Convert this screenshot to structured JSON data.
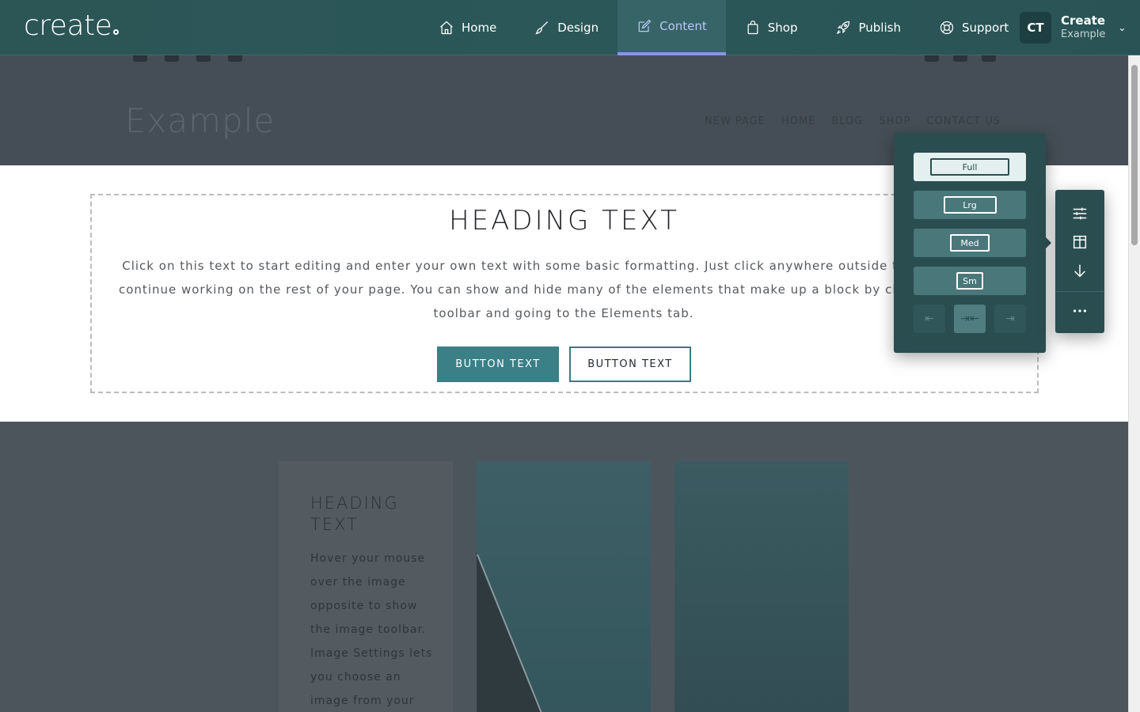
{
  "app": {
    "logo": "create",
    "nav": [
      {
        "label": "Home",
        "icon": "home-icon"
      },
      {
        "label": "Design",
        "icon": "brush-icon"
      },
      {
        "label": "Content",
        "icon": "edit-icon",
        "active": true
      },
      {
        "label": "Shop",
        "icon": "bag-icon"
      },
      {
        "label": "Publish",
        "icon": "rocket-icon"
      },
      {
        "label": "Support",
        "icon": "lifebuoy-icon"
      }
    ],
    "account": {
      "initials": "CT",
      "name": "Create",
      "site": "Example"
    }
  },
  "site": {
    "logo": "Example",
    "menu": [
      "NEW PAGE",
      "HOME",
      "BLOG",
      "SHOP",
      "CONTACT US"
    ]
  },
  "hero": {
    "heading": "HEADING TEXT",
    "paragraph_lines": [
      "Click on this text to start editing and enter your own text with some basic formatting. Just click anywhere outside the text box whe",
      "continue working on the rest of your page. You can show and hide many of the elements that make up a block by clicking Block Setting",
      "toolbar and going to the Elements tab."
    ],
    "button_primary": "BUTTON TEXT",
    "button_secondary": "BUTTON TEXT"
  },
  "lower": {
    "heading": "HEADING TEXT",
    "paragraph_lines": [
      "Hover your mouse",
      "over the image",
      "opposite to show",
      "the image toolbar.",
      "Image Settings lets",
      "you choose an",
      "image from your"
    ]
  },
  "width_popover": {
    "options": [
      {
        "label": "Full",
        "selected": true
      },
      {
        "label": "Lrg",
        "selected": false
      },
      {
        "label": "Med",
        "selected": false
      },
      {
        "label": "Sm",
        "selected": false
      }
    ],
    "alignment": [
      "align-left-icon",
      "align-center-icon",
      "align-right-icon"
    ],
    "active_alignment": "align-center-icon"
  },
  "block_toolbar": {
    "buttons": [
      "sliders-icon",
      "columns-icon",
      "arrow-down-icon",
      "more-icon"
    ]
  },
  "colors": {
    "app_bar": "#2b5758",
    "accent": "#8a95e4",
    "primary_button": "#3b7f87",
    "popover": "#2a4d50"
  }
}
